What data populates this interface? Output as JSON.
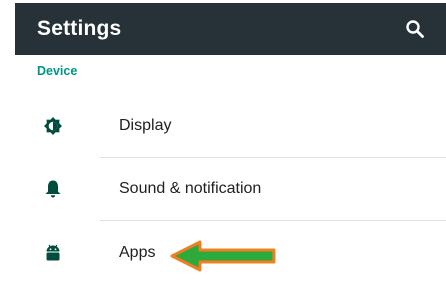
{
  "toolbar": {
    "title": "Settings",
    "background": "#263238",
    "search_icon": "search-icon"
  },
  "section": {
    "header": "Device",
    "accent": "#009688"
  },
  "items": [
    {
      "label": "Display",
      "icon": "brightness-icon"
    },
    {
      "label": "Sound & notification",
      "icon": "bell-icon"
    },
    {
      "label": "Apps",
      "icon": "android-icon"
    }
  ],
  "annotation": {
    "type": "arrow",
    "target": "Apps",
    "fill": "#2eaa3c",
    "outline": "#f07f21"
  }
}
